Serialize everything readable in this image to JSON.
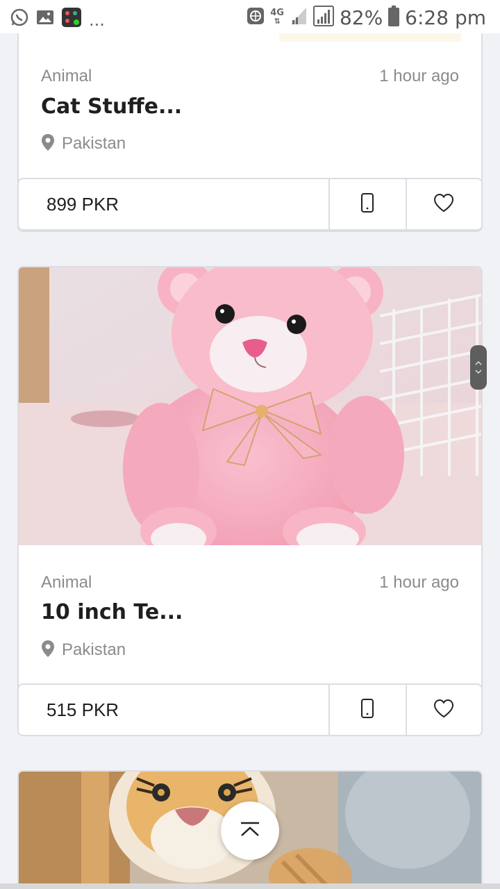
{
  "status_bar": {
    "battery": "82%",
    "time": "6:28 pm",
    "network": "4G",
    "more": "..."
  },
  "listings": [
    {
      "category": "Animal",
      "time_ago": "1 hour ago",
      "title": "Cat Stuffe...",
      "location": "Pakistan",
      "price": "899 PKR",
      "image": "cat-stuffed-toy"
    },
    {
      "category": "Animal",
      "time_ago": "1 hour ago",
      "title": "10 inch Te...",
      "location": "Pakistan",
      "price": "515 PKR",
      "image": "pink-teddy-bear"
    },
    {
      "image": "tiger-plush-toy"
    }
  ],
  "icons": {
    "location": "map-pin-icon",
    "phone": "phone-icon",
    "favorite": "heart-icon",
    "scroll_top": "chevron-up-icon"
  },
  "colors": {
    "background": "#f1f2f6",
    "card_border": "#dcdde2",
    "muted_text": "#8b8b8b",
    "title_text": "#1f1f1f"
  }
}
